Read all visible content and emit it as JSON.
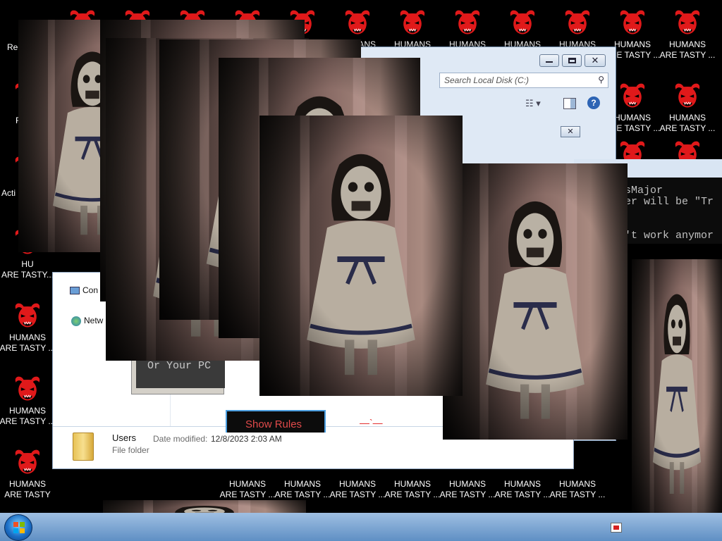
{
  "desktop": {
    "icon_label_line1": "HUMANS",
    "icon_label_line2": "ARE TASTY ...",
    "icon_label_line2_alt": "ARE TASTY",
    "recycle_label": "Rec",
    "active_label": "Acti",
    "f_label": "F",
    "partial_labels": [
      "IANS",
      "TASTY ...",
      "HU",
      "ARE T",
      "A"
    ]
  },
  "explorer": {
    "search_placeholder": "Search Local Disk (C:)",
    "nav_items": [
      {
        "label": "Con"
      },
      {
        "label": "Netw"
      }
    ],
    "details": {
      "name": "Users",
      "type": "File folder",
      "date_label": "Date modified:",
      "date_value": "12/8/2023 2:03 AM"
    }
  },
  "terminal": {
    "line1": "sMajor",
    "line2": "er will be \"Tr",
    "line3": "'t work anymor"
  },
  "prank_dialog": {
    "message": "Or Your PC",
    "button_label": "Show Rules",
    "dashes": "—`—"
  },
  "colors": {
    "demon_red": "#e0191a",
    "accent_blue": "#3a7dd1",
    "rules_text": "#e04a4a"
  }
}
